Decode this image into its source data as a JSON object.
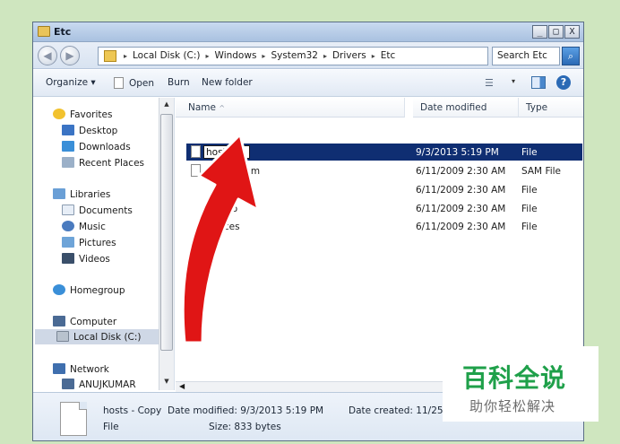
{
  "window": {
    "title": "Etc",
    "controls": {
      "minimize": "_",
      "maximize": "□",
      "close": "X"
    }
  },
  "address": {
    "back_icon": "back-arrow-icon",
    "forward_icon": "forward-arrow-icon",
    "crumbs": [
      "Local Disk (C:)",
      "Windows",
      "System32",
      "Drivers",
      "Etc"
    ],
    "separator": "▸",
    "dropdown": "▾",
    "refresh_icon": "refresh-icon"
  },
  "search": {
    "placeholder": "Search Etc",
    "icon": "search-icon"
  },
  "toolbar": {
    "organize": "Organize ▾",
    "open": "Open",
    "burn": "Burn",
    "new_folder": "New folder",
    "view_drop": "▾",
    "help": "?"
  },
  "nav": {
    "favorites": "Favorites",
    "desktop": "Desktop",
    "downloads": "Downloads",
    "recent_places": "Recent Places",
    "libraries": "Libraries",
    "documents": "Documents",
    "music": "Music",
    "pictures": "Pictures",
    "videos": "Videos",
    "homegroup": "Homegroup",
    "computer": "Computer",
    "local_disk": "Local Disk (C:)",
    "network": "Network",
    "anujkumar": "ANUJKUMAR"
  },
  "columns": {
    "name": "Name",
    "sort": "^",
    "date_modified": "Date modified",
    "type": "Type"
  },
  "files": [
    {
      "name": "hosts",
      "date": "9/3/2013 5:19 PM",
      "type": "File",
      "renaming": true
    },
    {
      "name": "sam",
      "date": "6/11/2009 2:30 AM",
      "type": "SAM File"
    },
    {
      "name": "",
      "date": "6/11/2009 2:30 AM",
      "type": "File"
    },
    {
      "name": "otoco",
      "date": "6/11/2009 2:30 AM",
      "type": "File"
    },
    {
      "name": "ervices",
      "date": "6/11/2009 2:30 AM",
      "type": "File"
    }
  ],
  "details": {
    "name": "hosts - Copy",
    "type": "File",
    "date_modified": "Date modified: 9/3/2013 5:19 PM",
    "size": "Size: 833 bytes",
    "date_created": "Date created: 11/25/2"
  },
  "watermark": {
    "title": "百科全说",
    "subtitle": "助你轻松解决"
  },
  "colors": {
    "selection": "#0f2e72",
    "arrow": "#e01515",
    "watermark_green": "#1fa04a"
  }
}
